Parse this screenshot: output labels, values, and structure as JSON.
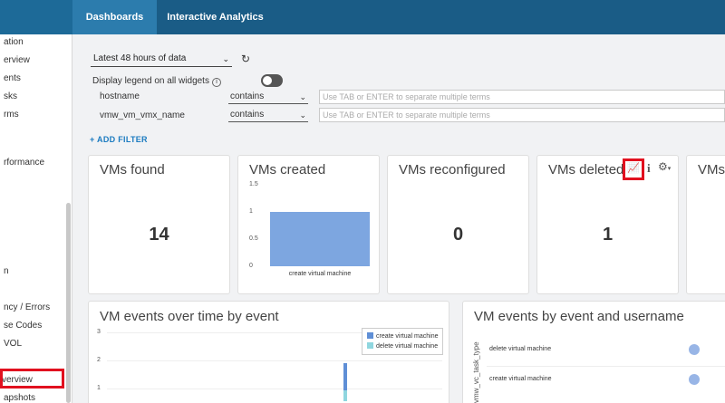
{
  "header": {
    "tabs": [
      {
        "label": "Dashboards",
        "active": true
      },
      {
        "label": "Interactive Analytics",
        "active": false
      }
    ]
  },
  "sidebar": {
    "items": [
      {
        "label": "ation"
      },
      {
        "label": "erview"
      },
      {
        "label": "ents"
      },
      {
        "label": "sks"
      },
      {
        "label": "rms"
      },
      {
        "label": "rformance"
      },
      {
        "label": "n"
      },
      {
        "label": "ncy / Errors"
      },
      {
        "label": "se Codes"
      },
      {
        "label": "VOL"
      },
      {
        "label": "verview",
        "selected": true
      },
      {
        "label": "apshots"
      }
    ]
  },
  "filters": {
    "time_range": "Latest 48 hours of data",
    "legend_toggle_label": "Display legend on all widgets",
    "rows": [
      {
        "field": "hostname",
        "operator": "contains",
        "placeholder": "Use TAB or ENTER to separate multiple terms"
      },
      {
        "field": "vmw_vm_vmx_name",
        "operator": "contains",
        "placeholder": "Use TAB or ENTER to separate multiple terms"
      }
    ],
    "add_filter_label": "+ ADD FILTER"
  },
  "widgets": {
    "vms_found": {
      "title": "VMs found",
      "value": "14"
    },
    "vms_created": {
      "title": "VMs created"
    },
    "vms_reconfigured": {
      "title": "VMs reconfigured",
      "value": "0"
    },
    "vms_deleted": {
      "title": "VMs deleted",
      "value": "1"
    },
    "vms_partial": {
      "title": "VMs"
    },
    "events_over_time": {
      "title": "VM events over time by event"
    },
    "events_by_user": {
      "title": "VM events by event and username",
      "y_axis_label": "vmw_vc_task_type"
    }
  },
  "colors": {
    "accent": "#1a5c86",
    "highlight": "#e1111f",
    "bar": "#7da6e0",
    "series_create": "#5f8fd6",
    "series_delete": "#8fd6df"
  },
  "chart_data": [
    {
      "type": "bar",
      "title": "VMs created",
      "categories": [
        "create virtual machine"
      ],
      "values": [
        1
      ],
      "ylim": [
        0,
        1.5
      ],
      "yticks": [
        "1.5",
        "1",
        "0.5",
        "0"
      ]
    },
    {
      "type": "bar",
      "title": "VM events over time by event",
      "stacked": true,
      "series": [
        {
          "name": "create virtual machine",
          "color": "#5f8fd6"
        },
        {
          "name": "delete virtual machine",
          "color": "#8fd6df"
        }
      ],
      "yticks": [
        "3",
        "2",
        "1"
      ],
      "legend": "top-right"
    },
    {
      "type": "scatter",
      "title": "VM events by event and username",
      "ylabel": "vmw_vc_task_type",
      "categories": [
        "delete virtual machine",
        "create virtual machine"
      ]
    }
  ]
}
